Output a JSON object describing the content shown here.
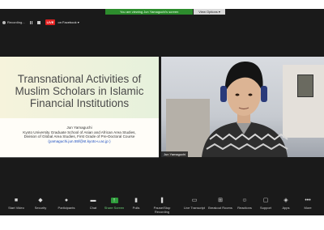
{
  "banner": {
    "message": "You are viewing Jun Yamaguchi's screen",
    "options": "View Options ▾"
  },
  "topbar": {
    "recording": "Recording...",
    "live": "LIVE",
    "facebook": "on Facebook ▾"
  },
  "slide": {
    "title": "Transnational Activities of Muslim Scholars in Islamic Financial Institutions",
    "author": "Jun Yamaguchi",
    "affiliation1": "Kyoto University Graduate School of Asian and African Area Studies,",
    "affiliation2": "Division of Global Area Studies, First Grade of Pre-Doctoral Course",
    "email": "(yamaguchi.jun.55f@st.kyoto-u.ac.jp )"
  },
  "video": {
    "participant_name": "Jun Yamaguchi"
  },
  "toolbar": [
    {
      "name": "start-video-button",
      "icon": "video-camera-icon",
      "glyph": "■",
      "label": "Start Video"
    },
    {
      "name": "security-button",
      "icon": "shield-icon",
      "glyph": "◆",
      "label": "Security"
    },
    {
      "name": "participants-button",
      "icon": "people-icon",
      "glyph": "●",
      "label": "Participants"
    },
    {
      "name": "chat-button",
      "icon": "chat-bubble-icon",
      "glyph": "▬",
      "label": "Chat"
    },
    {
      "name": "share-screen-button",
      "icon": "share-arrow-icon",
      "glyph": "↑",
      "label": "Share Screen"
    },
    {
      "name": "polls-button",
      "icon": "bar-chart-icon",
      "glyph": "▮",
      "label": "Polls"
    },
    {
      "name": "pause-stop-recording-button",
      "icon": "pause-stop-icon",
      "glyph": "❚",
      "label": "Pause/Stop Recording"
    },
    {
      "name": "live-transcript-button",
      "icon": "cc-icon",
      "glyph": "▭",
      "label": "Live Transcript"
    },
    {
      "name": "breakout-rooms-button",
      "icon": "grid-icon",
      "glyph": "⊞",
      "label": "Breakout Rooms"
    },
    {
      "name": "reactions-button",
      "icon": "smiley-icon",
      "glyph": "☺",
      "label": "Reactions"
    },
    {
      "name": "support-button",
      "icon": "speech-icon",
      "glyph": "▢",
      "label": "Support"
    },
    {
      "name": "apps-button",
      "icon": "apps-icon",
      "glyph": "◈",
      "label": "Apps"
    },
    {
      "name": "more-button",
      "icon": "ellipsis-icon",
      "glyph": "•••",
      "label": "More"
    }
  ]
}
